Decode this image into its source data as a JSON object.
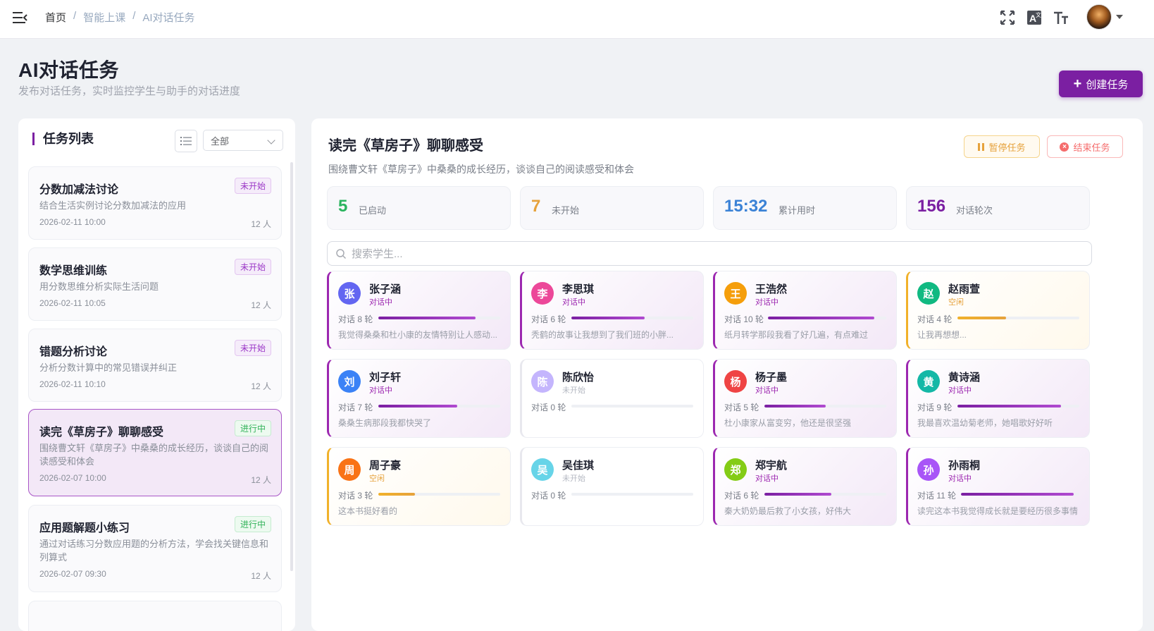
{
  "breadcrumb": {
    "home": "首页",
    "section": "智能上课",
    "current": "AI对话任务",
    "separator": "/"
  },
  "topbar_icons": [
    "fullscreen-icon",
    "translate-icon",
    "font-size-icon"
  ],
  "header": {
    "title": "AI对话任务",
    "subtitle": "发布对话任务，实时监控学生与助手的对话进度",
    "create_button": "创建任务"
  },
  "task_list": {
    "title": "任务列表",
    "filter_value": "全部",
    "tasks": [
      {
        "title": "分数加减法讨论",
        "status": "未开始",
        "status_type": "pending",
        "desc": "结合生活实例讨论分数加减法的应用",
        "date": "2026-02-11 10:00",
        "count": "12 人",
        "active": false
      },
      {
        "title": "数学思维训练",
        "status": "未开始",
        "status_type": "pending",
        "desc": "用分数思维分析实际生活问题",
        "date": "2026-02-11 10:05",
        "count": "12 人",
        "active": false
      },
      {
        "title": "错题分析讨论",
        "status": "未开始",
        "status_type": "pending",
        "desc": "分析分数计算中的常见错误并纠正",
        "date": "2026-02-11 10:10",
        "count": "12 人",
        "active": false
      },
      {
        "title": "读完《草房子》聊聊感受",
        "status": "进行中",
        "status_type": "running",
        "desc": "围绕曹文轩《草房子》中桑桑的成长经历，谈谈自己的阅读感受和体会",
        "date": "2026-02-07 10:00",
        "count": "12 人",
        "active": true
      },
      {
        "title": "应用题解题小练习",
        "status": "进行中",
        "status_type": "running",
        "desc": "通过对话练习分数应用题的分析方法，学会找关键信息和列算式",
        "date": "2026-02-07 09:30",
        "count": "12 人",
        "active": false
      }
    ]
  },
  "detail": {
    "title": "读完《草房子》聊聊感受",
    "desc": "围绕曹文轩《草房子》中桑桑的成长经历，谈谈自己的阅读感受和体会",
    "pause_button": "暂停任务",
    "end_button": "结束任务",
    "stats": [
      {
        "value": "5",
        "label": "已启动",
        "color": "#2bb45f"
      },
      {
        "value": "7",
        "label": "未开始",
        "color": "#e6a23c"
      },
      {
        "value": "15:32",
        "label": "累计用时",
        "color": "#3b82d6"
      },
      {
        "value": "156",
        "label": "对话轮次",
        "color": "#7b1fa2"
      }
    ],
    "search_placeholder": "搜索学生...",
    "students": [
      {
        "initial": "张",
        "name": "张子涵",
        "status": "对话中",
        "state": "talking",
        "rounds": "对话 8 轮",
        "progress": 0.8,
        "message": "我觉得桑桑和杜小康的友情特别让人感动...",
        "avatar_color": "#6366f1"
      },
      {
        "initial": "李",
        "name": "李思琪",
        "status": "对话中",
        "state": "talking",
        "rounds": "对话 6 轮",
        "progress": 0.6,
        "message": "秃鹤的故事让我想到了我们班的小胖...",
        "avatar_color": "#ec4899"
      },
      {
        "initial": "王",
        "name": "王浩然",
        "status": "对话中",
        "state": "talking",
        "rounds": "对话 10 轮",
        "progress": 0.9,
        "message": "纸月转学那段我看了好几遍，有点难过",
        "avatar_color": "#f59e0b"
      },
      {
        "initial": "赵",
        "name": "赵雨萱",
        "status": "空闲",
        "state": "idle",
        "rounds": "对话 4 轮",
        "progress": 0.4,
        "message": "让我再想想...",
        "avatar_color": "#10b981"
      },
      {
        "initial": "刘",
        "name": "刘子轩",
        "status": "对话中",
        "state": "talking",
        "rounds": "对话 7 轮",
        "progress": 0.65,
        "message": "桑桑生病那段我都快哭了",
        "avatar_color": "#3b82f6"
      },
      {
        "initial": "陈",
        "name": "陈欣怡",
        "status": "未开始",
        "state": "notstarted",
        "rounds": "对话 0 轮",
        "progress": 0,
        "message": "",
        "avatar_color": "#c4b5fd"
      },
      {
        "initial": "杨",
        "name": "杨子墨",
        "status": "对话中",
        "state": "talking",
        "rounds": "对话 5 轮",
        "progress": 0.5,
        "message": "杜小康家从富变穷，他还是很坚强",
        "avatar_color": "#ef4444"
      },
      {
        "initial": "黄",
        "name": "黄诗涵",
        "status": "对话中",
        "state": "talking",
        "rounds": "对话 9 轮",
        "progress": 0.85,
        "message": "我最喜欢温幼菊老师，她唱歌好好听",
        "avatar_color": "#14b8a6"
      },
      {
        "initial": "周",
        "name": "周子豪",
        "status": "空闲",
        "state": "idle",
        "rounds": "对话 3 轮",
        "progress": 0.3,
        "message": "这本书挺好看的",
        "avatar_color": "#f97316"
      },
      {
        "initial": "吴",
        "name": "吴佳琪",
        "status": "未开始",
        "state": "notstarted",
        "rounds": "对话 0 轮",
        "progress": 0,
        "message": "",
        "avatar_color": "#67d4e8"
      },
      {
        "initial": "郑",
        "name": "郑宇航",
        "status": "对话中",
        "state": "talking",
        "rounds": "对话 6 轮",
        "progress": 0.55,
        "message": "秦大奶奶最后救了小女孩，好伟大",
        "avatar_color": "#84cc16"
      },
      {
        "initial": "孙",
        "name": "孙雨桐",
        "status": "对话中",
        "state": "talking",
        "rounds": "对话 11 轮",
        "progress": 0.95,
        "message": "读完这本书我觉得成长就是要经历很多事情",
        "avatar_color": "#a855f7"
      }
    ]
  }
}
